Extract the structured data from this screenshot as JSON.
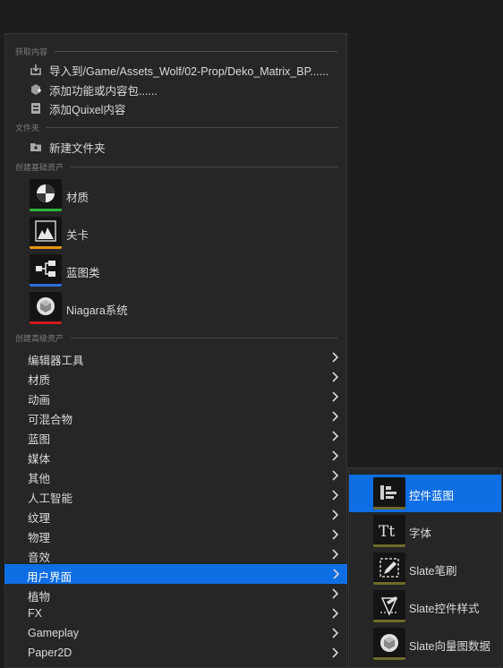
{
  "menu": {
    "sections": {
      "get_content": "获取内容",
      "folder": "文件夹",
      "basic_assets": "创建基础资产",
      "advanced_assets": "创建高级资产"
    },
    "get_content_items": [
      {
        "label": "导入到/Game/Assets_Wolf/02-Prop/Deko_Matrix_BP......",
        "icon": "import-icon"
      },
      {
        "label": "添加功能或内容包......",
        "icon": "feature-pack-icon"
      },
      {
        "label": "添加Quixel内容",
        "icon": "quixel-icon"
      }
    ],
    "folder_items": [
      {
        "label": "新建文件夹",
        "icon": "new-folder-icon"
      }
    ],
    "basic_assets": [
      {
        "label": "材质",
        "icon": "material-icon",
        "color": "#2db53a"
      },
      {
        "label": "关卡",
        "icon": "level-icon",
        "color": "#e39612"
      },
      {
        "label": "蓝图类",
        "icon": "blueprint-class-icon",
        "color": "#2c6fe0"
      },
      {
        "label": "Niagara系统",
        "icon": "niagara-icon",
        "color": "#cf1b1b"
      }
    ],
    "advanced_categories": [
      "编辑器工具",
      "材质",
      "动画",
      "可混合物",
      "蓝图",
      "媒体",
      "其他",
      "人工智能",
      "纹理",
      "物理",
      "音效",
      "用户界面",
      "植物",
      "FX",
      "Gameplay",
      "Paper2D"
    ],
    "selected_category": "用户界面"
  },
  "submenu": {
    "items": [
      {
        "label": "控件蓝图",
        "icon": "widget-blueprint-icon",
        "selected": true
      },
      {
        "label": "字体",
        "icon": "font-icon"
      },
      {
        "label": "Slate笔刷",
        "icon": "slate-brush-icon"
      },
      {
        "label": "Slate控件样式",
        "icon": "slate-widget-style-icon"
      },
      {
        "label": "Slate向量图数据",
        "icon": "slate-vector-data-icon"
      }
    ]
  },
  "colors": {
    "selection": "#0e6ee3",
    "submenu_bar": "#6f6a2a"
  }
}
